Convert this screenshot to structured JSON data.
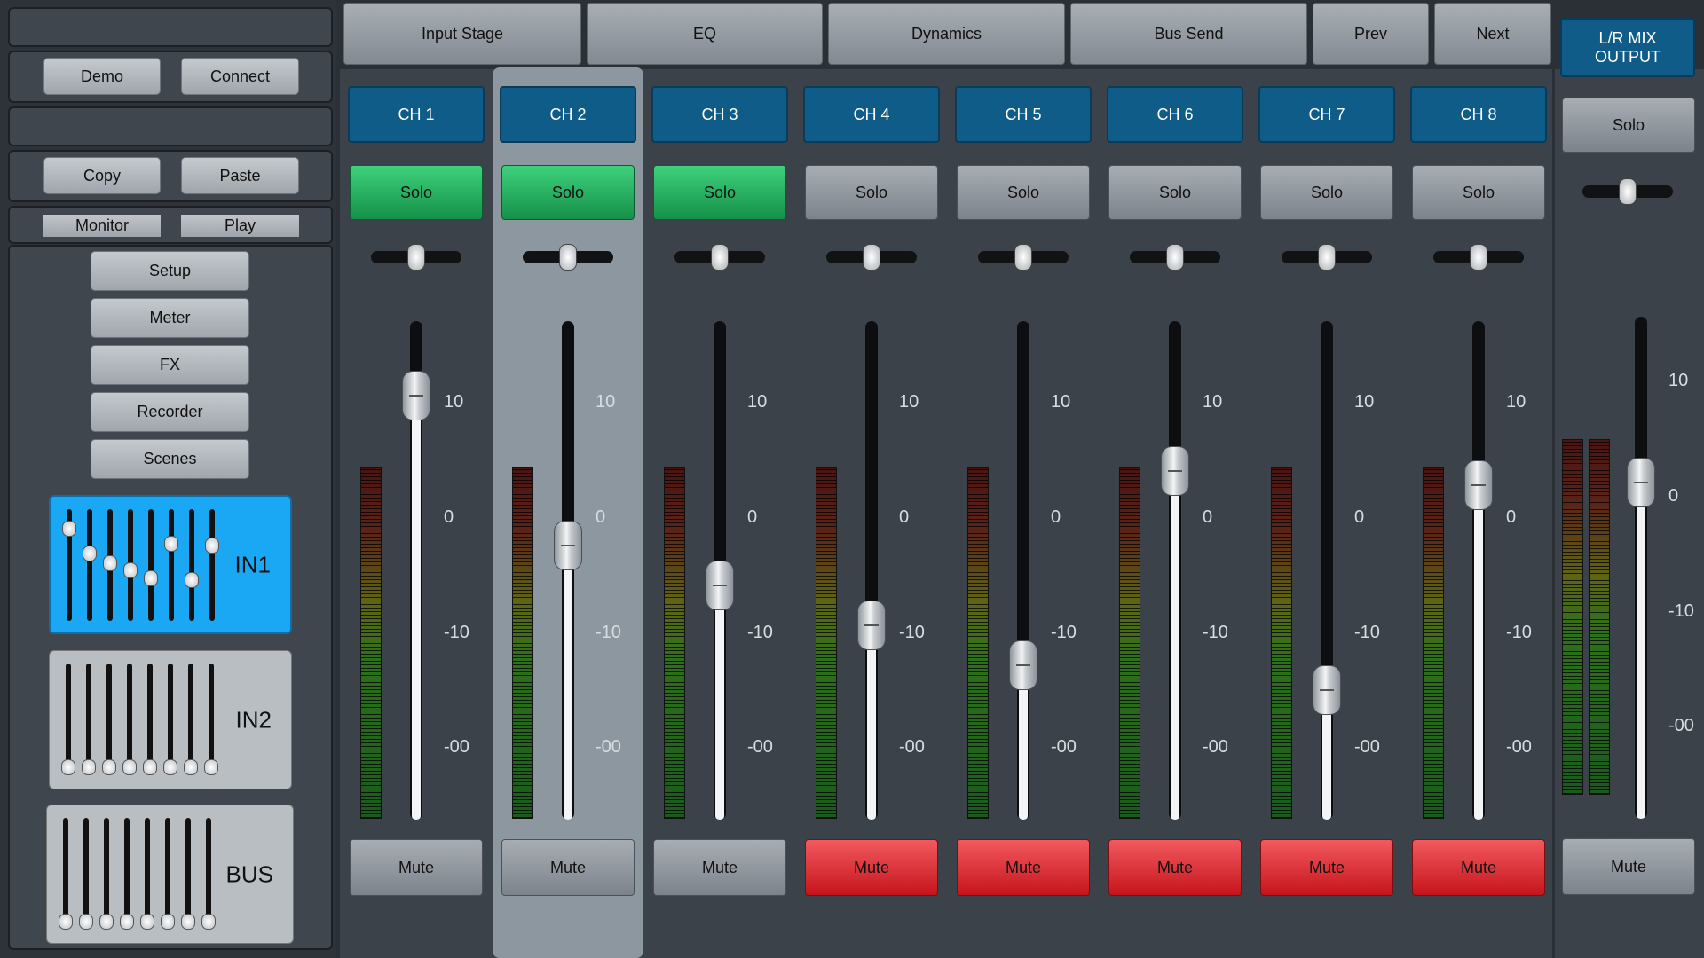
{
  "left": {
    "demo": "Demo",
    "connect": "Connect",
    "copy": "Copy",
    "paste": "Paste",
    "monitor": "Monitor",
    "play": "Play",
    "nav": [
      "Setup",
      "Meter",
      "FX",
      "Recorder",
      "Scenes"
    ],
    "layers": [
      {
        "label": "IN1",
        "active": true
      },
      {
        "label": "IN2",
        "active": false
      },
      {
        "label": "BUS",
        "active": false
      }
    ]
  },
  "topbar": {
    "tabs": [
      "Input Stage",
      "EQ",
      "Dynamics",
      "Bus Send"
    ],
    "prev": "Prev",
    "next": "Next"
  },
  "scale": [
    "10",
    "0",
    "-10",
    "-00"
  ],
  "channels": [
    {
      "name": "CH 1",
      "solo": "Solo",
      "solo_on": true,
      "mute": "Mute",
      "mute_on": false,
      "level": 0.85,
      "pan": 0.5
    },
    {
      "name": "CH 2",
      "solo": "Solo",
      "solo_on": true,
      "mute": "Mute",
      "mute_on": false,
      "level": 0.55,
      "pan": 0.5,
      "selected": true
    },
    {
      "name": "CH 3",
      "solo": "Solo",
      "solo_on": true,
      "mute": "Mute",
      "mute_on": false,
      "level": 0.47,
      "pan": 0.5
    },
    {
      "name": "CH 4",
      "solo": "Solo",
      "solo_on": false,
      "mute": "Mute",
      "mute_on": true,
      "level": 0.39,
      "pan": 0.5
    },
    {
      "name": "CH 5",
      "solo": "Solo",
      "solo_on": false,
      "mute": "Mute",
      "mute_on": true,
      "level": 0.31,
      "pan": 0.5
    },
    {
      "name": "CH 6",
      "solo": "Solo",
      "solo_on": false,
      "mute": "Mute",
      "mute_on": true,
      "level": 0.7,
      "pan": 0.5
    },
    {
      "name": "CH 7",
      "solo": "Solo",
      "solo_on": false,
      "mute": "Mute",
      "mute_on": true,
      "level": 0.26,
      "pan": 0.5
    },
    {
      "name": "CH 8",
      "solo": "Solo",
      "solo_on": false,
      "mute": "Mute",
      "mute_on": true,
      "level": 0.67,
      "pan": 0.5
    }
  ],
  "master": {
    "name_line1": "L/R MIX",
    "name_line2": "OUTPUT",
    "solo": "Solo",
    "mute": "Mute",
    "level": 0.67,
    "pan": 0.5
  },
  "colors": {
    "channel_header": "#0f5c88",
    "solo_active": "#1fa95a",
    "mute_active": "#e02a30",
    "layer_active": "#1aa8f5"
  }
}
